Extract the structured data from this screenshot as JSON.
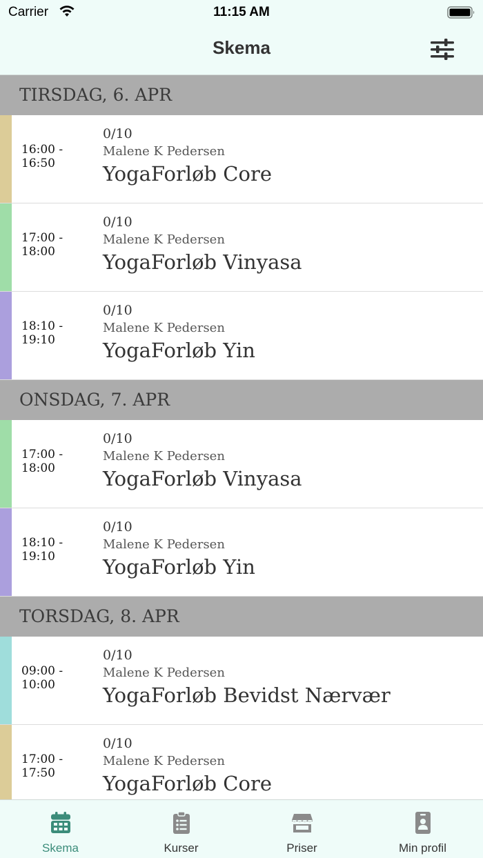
{
  "status_bar": {
    "carrier": "Carrier",
    "time": "11:15 AM"
  },
  "nav": {
    "title": "Skema",
    "filter_icon": "sliders-icon"
  },
  "days": [
    {
      "label": "TIRSDAG, 6. APR",
      "classes": [
        {
          "time_start": "16:00 -",
          "time_end": "16:50",
          "spots": "0/10",
          "teacher": "Malene K Pedersen",
          "name": "YogaForløb Core",
          "color": "#dccc98"
        },
        {
          "time_start": "17:00 -",
          "time_end": "18:00",
          "spots": "0/10",
          "teacher": "Malene K Pedersen",
          "name": "YogaForløb Vinyasa",
          "color": "#9fdda8"
        },
        {
          "time_start": "18:10 -",
          "time_end": "19:10",
          "spots": "0/10",
          "teacher": "Malene K Pedersen",
          "name": "YogaForløb Yin",
          "color": "#ab9fdd"
        }
      ]
    },
    {
      "label": "ONSDAG, 7. APR",
      "classes": [
        {
          "time_start": "17:00 -",
          "time_end": "18:00",
          "spots": "0/10",
          "teacher": "Malene K Pedersen",
          "name": "YogaForløb Vinyasa",
          "color": "#9fdda8"
        },
        {
          "time_start": "18:10 -",
          "time_end": "19:10",
          "spots": "0/10",
          "teacher": "Malene K Pedersen",
          "name": "YogaForløb Yin",
          "color": "#ab9fdd"
        }
      ]
    },
    {
      "label": "TORSDAG, 8. APR",
      "classes": [
        {
          "time_start": "09:00 -",
          "time_end": "10:00",
          "spots": "0/10",
          "teacher": "Malene K Pedersen",
          "name": "YogaForløb Bevidst Nærvær",
          "color": "#9fdddb"
        },
        {
          "time_start": "17:00 -",
          "time_end": "17:50",
          "spots": "0/10",
          "teacher": "Malene K Pedersen",
          "name": "YogaForløb Core",
          "color": "#dccc98"
        }
      ]
    }
  ],
  "tabs": [
    {
      "label": "Skema",
      "icon": "calendar-icon",
      "active": true
    },
    {
      "label": "Kurser",
      "icon": "clipboard-list-icon",
      "active": false
    },
    {
      "label": "Priser",
      "icon": "store-icon",
      "active": false
    },
    {
      "label": "Min profil",
      "icon": "id-badge-icon",
      "active": false
    }
  ],
  "colors": {
    "accent": "#3b8c7a",
    "inactive_icon": "#8a8a8a",
    "header_bg": "#effcf9",
    "day_header_bg": "#acacac"
  }
}
